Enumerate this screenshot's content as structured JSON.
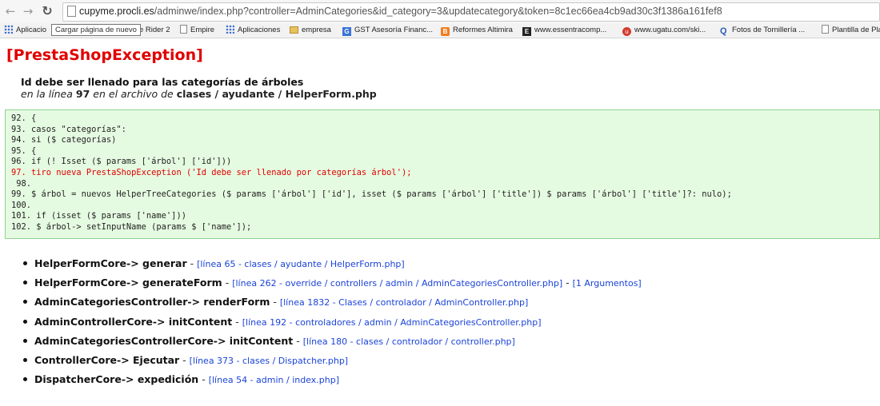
{
  "browser": {
    "url_host": "cupyme.procli.es",
    "url_path": "/adminwe/index.php?controller=AdminCategories&id_category=3&updatecategory&token=8c1ec66ea4cb9ad30c3f1386a161fef8",
    "tooltip": "Cargar página de nuevo",
    "bookmarks": [
      "Aplicacio",
      "e Rider 2",
      "Empire",
      "Aplicaciones",
      "empresa",
      "GST Asesoría Financ...",
      "Reformes Altimira",
      "www.essentracomp...",
      "www.ugatu.com/ski...",
      "Fotos de Tornillería ...",
      "Plantilla de Pla"
    ]
  },
  "page": {
    "title": "[PrestaShopException]",
    "message": "Id debe ser llenado para las categorías de árboles",
    "location_prefix": "en la línea",
    "line": "97",
    "location_mid": "en el archivo de",
    "file": "clases / ayudante / HelperForm.php"
  },
  "code_lines": [
    {
      "text": "92. {",
      "error": false
    },
    {
      "text": "93. casos \"categorías\":",
      "error": false
    },
    {
      "text": "94. si ($ categorías)",
      "error": false
    },
    {
      "text": "95. {",
      "error": false
    },
    {
      "text": "96. if (! Isset ($ params ['árbol'] ['id']))",
      "error": false
    },
    {
      "text": "97. tiro nueva PrestaShopException ('Id debe ser llenado por categorías árbol');",
      "error": true
    },
    {
      "text": " 98.",
      "error": false
    },
    {
      "text": "99. $ árbol = nuevos HelperTreeCategories ($ params ['árbol'] ['id'], isset ($ params ['árbol'] ['title']) $ params ['árbol'] ['title']?: nulo);",
      "error": false
    },
    {
      "text": "100.",
      "error": false
    },
    {
      "text": "101. if (isset ($ params ['name']))",
      "error": false
    },
    {
      "text": "102. $ árbol-> setInputName (params $ ['name']);",
      "error": false
    }
  ],
  "trace": [
    {
      "fn": "HelperFormCore-> generar",
      "link": "[línea 65 - clases / ayudante / HelperForm.php]",
      "extra": ""
    },
    {
      "fn": "HelperFormCore-> generateForm",
      "link": "[línea 262 - override / controllers / admin / AdminCategoriesController.php]",
      "extra": "[1 Argumentos]"
    },
    {
      "fn": "AdminCategoriesController-> renderForm",
      "link": "[línea 1832 - Clases / controlador / AdminController.php]",
      "extra": ""
    },
    {
      "fn": "AdminControllerCore-> initContent",
      "link": "[línea 192 - controladores / admin / AdminCategoriesController.php]",
      "extra": ""
    },
    {
      "fn": "AdminCategoriesControllerCore-> initContent",
      "link": "[línea 180 - clases / controlador / controller.php]",
      "extra": ""
    },
    {
      "fn": "ControllerCore-> Ejecutar",
      "link": "[línea 373 - clases / Dispatcher.php]",
      "extra": ""
    },
    {
      "fn": "DispatcherCore-> expedición",
      "link": "[línea 54 - admin / index.php]",
      "extra": ""
    }
  ]
}
